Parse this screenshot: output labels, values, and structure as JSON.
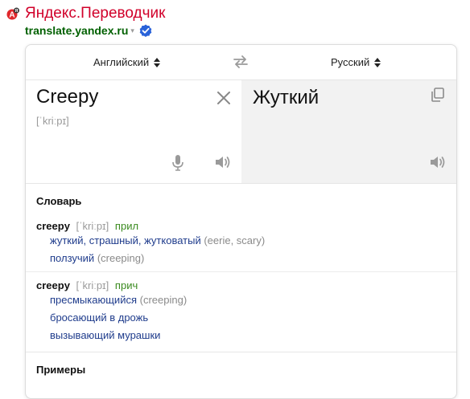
{
  "result": {
    "title": "Яндекс.Переводчик",
    "url": "translate.yandex.ru",
    "url_caret": "▾",
    "colors": {
      "title": "#d1002a",
      "url": "#006000",
      "verified": "#1a73e8"
    }
  },
  "translator": {
    "source_language": "Английский",
    "target_language": "Русский",
    "source_text": "Creepy",
    "source_transcription": "[ˈkriːpɪ]",
    "translation": "Жуткий",
    "icons": {
      "sort": "sort-arrows-icon",
      "swap": "swap-arrows-icon",
      "clear": "close-icon",
      "mic": "microphone-icon",
      "speaker": "speaker-icon",
      "copy": "copy-icon"
    }
  },
  "dictionary": {
    "title": "Словарь",
    "entries": [
      {
        "word": "creepy",
        "transcription": "[ˈkriːpɪ]",
        "pos": "прил",
        "senses": [
          {
            "text": "жуткий, страшный, жутковатый",
            "synonyms": "(eerie, scary)"
          },
          {
            "text": "ползучий",
            "synonyms": "(creeping)"
          }
        ]
      },
      {
        "word": "creepy",
        "transcription": "[ˈkriːpɪ]",
        "pos": "прич",
        "senses": [
          {
            "text": "пресмыкающийся",
            "synonyms": "(creeping)"
          },
          {
            "text": "бросающий в дрожь",
            "synonyms": ""
          },
          {
            "text": "вызывающий мурашки",
            "synonyms": ""
          }
        ]
      }
    ]
  },
  "examples": {
    "title": "Примеры"
  }
}
